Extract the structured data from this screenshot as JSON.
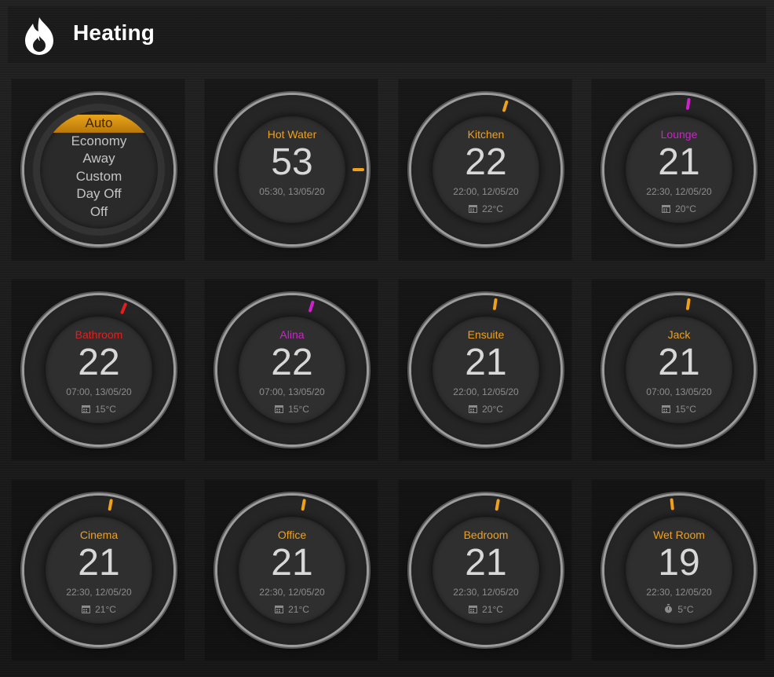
{
  "header": {
    "title": "Heating",
    "icon": "flame-icon"
  },
  "mode_selector": {
    "options": [
      "Auto",
      "Economy",
      "Away",
      "Custom",
      "Day Off",
      "Off"
    ],
    "selected": "Auto",
    "accent": "#e9a51a"
  },
  "zones": [
    {
      "name": "Hot Water",
      "temp": "53",
      "time": "05:30, 13/05/20",
      "setpoint": "",
      "color": "#f0a01a"
    },
    {
      "name": "Kitchen",
      "temp": "22",
      "time": "22:00, 12/05/20",
      "setpoint": "22°C",
      "setpoint_icon": "calendar-icon",
      "color": "#f0a01a"
    },
    {
      "name": "Lounge",
      "temp": "21",
      "time": "22:30, 12/05/20",
      "setpoint": "20°C",
      "setpoint_icon": "calendar-icon",
      "color": "#d21fcf"
    },
    {
      "name": "Bathroom",
      "temp": "22",
      "time": "07:00, 13/05/20",
      "setpoint": "15°C",
      "setpoint_icon": "calendar-icon",
      "color": "#e02020"
    },
    {
      "name": "Alina",
      "temp": "22",
      "time": "07:00, 13/05/20",
      "setpoint": "15°C",
      "setpoint_icon": "calendar-icon",
      "color": "#d21fcf"
    },
    {
      "name": "Ensuite",
      "temp": "21",
      "time": "22:00, 12/05/20",
      "setpoint": "20°C",
      "setpoint_icon": "calendar-icon",
      "color": "#f0a01a"
    },
    {
      "name": "Jack",
      "temp": "21",
      "time": "07:00, 13/05/20",
      "setpoint": "15°C",
      "setpoint_icon": "calendar-icon",
      "color": "#f0a01a"
    },
    {
      "name": "Cinema",
      "temp": "21",
      "time": "22:30, 12/05/20",
      "setpoint": "21°C",
      "setpoint_icon": "calendar-icon",
      "color": "#f0a01a"
    },
    {
      "name": "Office",
      "temp": "21",
      "time": "22:30, 12/05/20",
      "setpoint": "21°C",
      "setpoint_icon": "calendar-icon",
      "color": "#f0a01a"
    },
    {
      "name": "Bedroom",
      "temp": "21",
      "time": "22:30, 12/05/20",
      "setpoint": "21°C",
      "setpoint_icon": "calendar-icon",
      "color": "#f0a01a"
    },
    {
      "name": "Wet Room",
      "temp": "19",
      "time": "22:30, 12/05/20",
      "setpoint": "5°C",
      "setpoint_icon": "stopwatch-icon",
      "color": "#f0a01a"
    }
  ]
}
